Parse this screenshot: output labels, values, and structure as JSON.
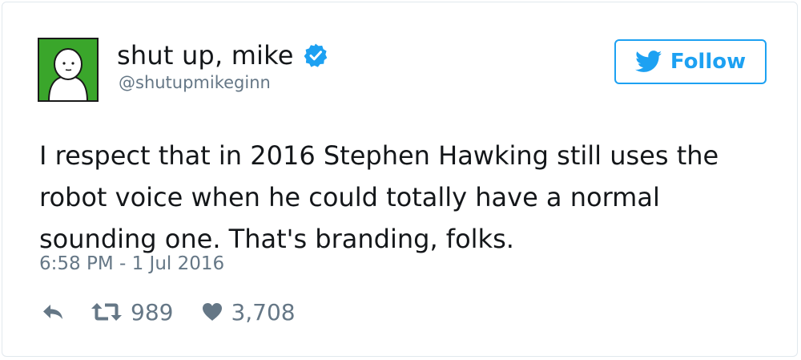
{
  "user": {
    "display_name": "shut up, mike",
    "handle": "@shutupmikeginn",
    "verified": true,
    "avatar_icon": "cartoon-person-avatar"
  },
  "follow_button": {
    "label": "Follow",
    "icon": "twitter-bird-icon"
  },
  "tweet": {
    "text_lines": [
      "I respect that in 2016 Stephen Hawking still uses the",
      "robot voice when he could totally have a normal",
      "sounding one. That's branding, folks."
    ],
    "timestamp": "6:58 PM - 1 Jul 2016"
  },
  "actions": {
    "reply_icon": "reply-icon",
    "retweet_icon": "retweet-icon",
    "retweet_count": "989",
    "like_icon": "heart-icon",
    "like_count": "3,708"
  },
  "colors": {
    "accent": "#1da1f2",
    "secondary_text": "#657786",
    "primary_text": "#14171a",
    "avatar_bg": "#3aa62b",
    "verified": "#1da1f2"
  }
}
